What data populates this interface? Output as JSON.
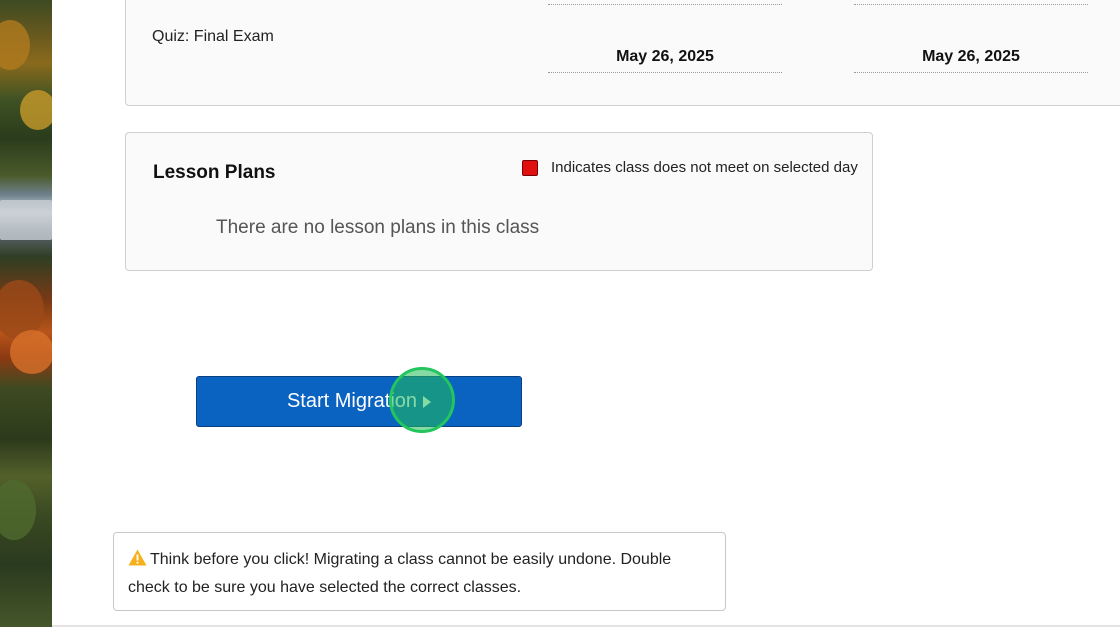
{
  "assessment_row": {
    "label": "Quiz: Final Exam",
    "dates": [
      "May 26, 2025",
      "May 26, 2025"
    ]
  },
  "lesson_plans": {
    "title": "Lesson Plans",
    "legend_text": "Indicates class does not meet on selected day",
    "legend_color": "#e01010",
    "empty_message": "There are no lesson plans in this class"
  },
  "actions": {
    "start_label": "Start Migration",
    "button_color": "#0a62c1"
  },
  "warning": {
    "icon": "warning-triangle-icon",
    "text": "Think before you click! Migrating a class cannot be easily undone. Double check to be sure you have selected the correct classes."
  }
}
